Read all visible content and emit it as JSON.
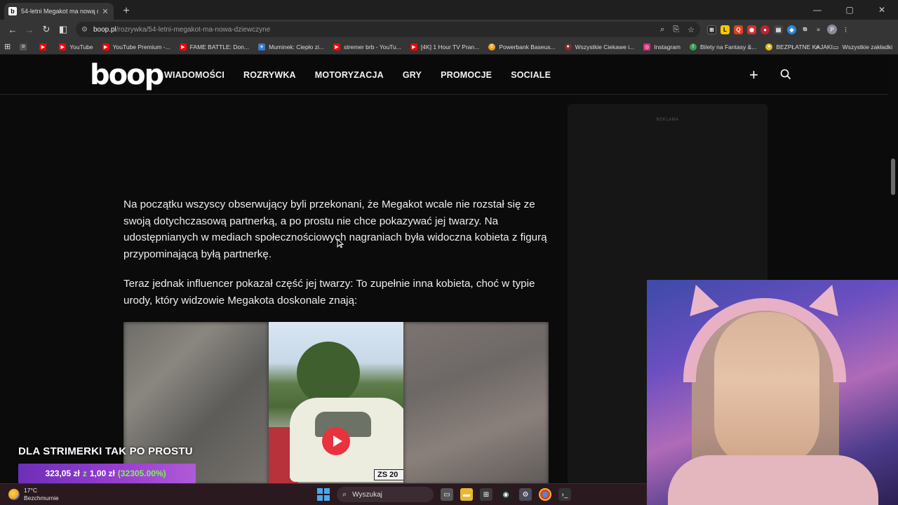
{
  "browser": {
    "tab_title": "54-letni Megakot ma nową dzie",
    "tab_favicon": "b",
    "new_tab": "+",
    "url_host": "boop.pl",
    "url_path": "/rozrywka/54-letni-megakot-ma-nowa-dziewczyne",
    "window_controls": [
      "—",
      "▢",
      "✕"
    ]
  },
  "bookmarks": {
    "items": [
      {
        "label": "",
        "color": "#555555",
        "icon": "o"
      },
      {
        "label": "",
        "color": "#ff0000",
        "icon": "▶"
      },
      {
        "label": "YouTube",
        "color": "#ff0000",
        "icon": "▶"
      },
      {
        "label": "YouTube Premium -...",
        "color": "#ff0000",
        "icon": "▶"
      },
      {
        "label": "FAME BATTLE: Don...",
        "color": "#ff0000",
        "icon": "▶"
      },
      {
        "label": "Muminek: Ciepło zi...",
        "color": "#3a78c8",
        "icon": "✈"
      },
      {
        "label": "stremer brb - YouTu...",
        "color": "#ff0000",
        "icon": "▶"
      },
      {
        "label": "[4K] 1 Hour TV Pran...",
        "color": "#ff0000",
        "icon": "▶"
      },
      {
        "label": "Powerbank Baseus...",
        "color": "#f0a020",
        "icon": "E"
      },
      {
        "label": "Wszystkie Ciekawe i...",
        "color": "#8a2a2a",
        "icon": "●"
      },
      {
        "label": "Instagram",
        "color": "#d6307a",
        "icon": "◎"
      },
      {
        "label": "Bilety na Fantasy &...",
        "color": "#3aa050",
        "icon": "t"
      },
      {
        "label": "BEZPŁATNE KAJAKI...",
        "color": "#e0c020",
        "icon": "●"
      }
    ],
    "more": "»",
    "all_bookmarks": "Wszystkie zakładki"
  },
  "site": {
    "logo": "boop",
    "nav": [
      "WIADOMOŚCI",
      "ROZRYWKA",
      "MOTORYZACJA",
      "GRY",
      "PROMOCJE",
      "SOCIALE"
    ],
    "plus": "+",
    "ad_label": "REKLAMA"
  },
  "article": {
    "p1": "Na początku wszyscy obserwujący byli przekonani, że Megakot wcale nie rozstał się ze swoją dotychczasową partnerką, a po prostu nie chce pokazywać jej twarzy. Na udostępnianych w mediach społecznościowych nagraniach była widoczna kobieta z figurą przypominającą byłą partnerkę.",
    "p2": "Teraz jednak influencer pokazał część jej twarzy: To zupełnie inna kobieta, choć w typie urody, który widzowie Megakota doskonale znają:",
    "plate": "ZS 20"
  },
  "overlay": {
    "donation_title": "DLA STRIMERKI TAK PO PROSTU",
    "amount": "323,05 zł",
    "sep": "z",
    "goal": "1,00 zł",
    "percent": "(32305.00%)"
  },
  "taskbar": {
    "temp": "17°C",
    "weather": "Bezchmurnie",
    "search_placeholder": "Wyszukaj"
  }
}
